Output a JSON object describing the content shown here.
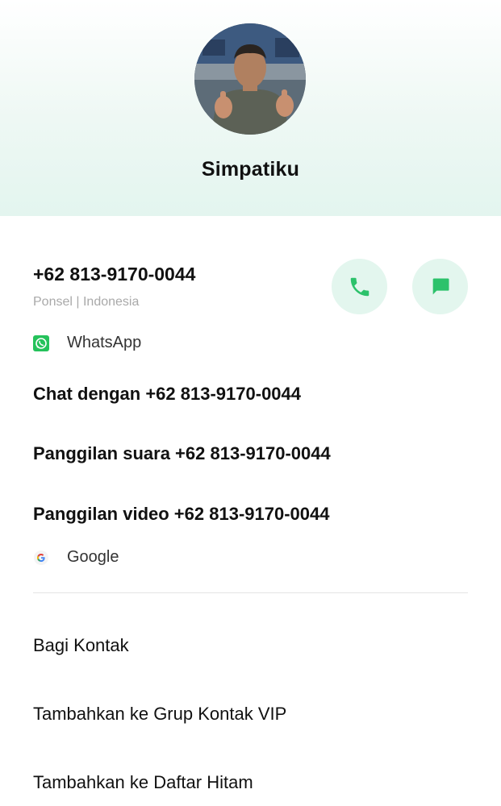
{
  "contact": {
    "name": "Simpatiku",
    "phone": "+62 813-9170-0044",
    "phone_type": "Ponsel | Indonesia"
  },
  "buttons": {
    "call_icon": "phone-icon",
    "message_icon": "message-icon"
  },
  "whatsapp": {
    "label": "WhatsApp",
    "actions": [
      "Chat dengan +62 813-9170-0044",
      "Panggilan suara +62 813-9170-0044",
      "Panggilan video +62 813-9170-0044"
    ]
  },
  "google": {
    "label": "Google"
  },
  "menu": {
    "items": [
      "Bagi Kontak",
      "Tambahkan ke Grup Kontak VIP",
      "Tambahkan ke Daftar Hitam"
    ]
  },
  "colors": {
    "accent": "#2cc26b",
    "button_bg": "#e3f6ee",
    "header_bg": "#e3f5ef",
    "secondary_text": "#a9a9a9"
  }
}
